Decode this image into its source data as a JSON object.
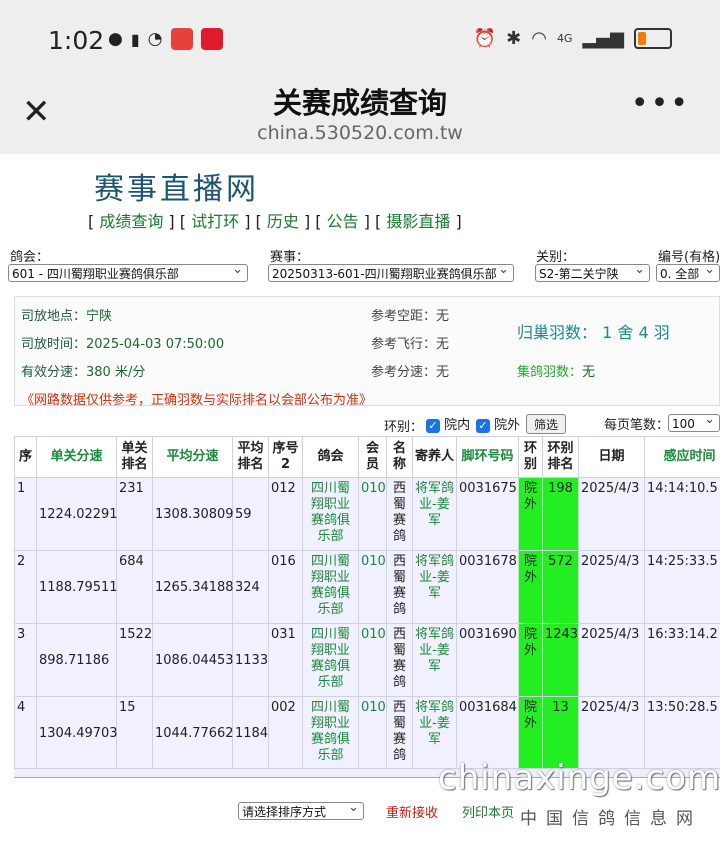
{
  "status_bar": {
    "time": "1:02",
    "network": "4G"
  },
  "nav": {
    "title": "关赛成绩查询",
    "url": "china.530520.com.tw"
  },
  "site": {
    "logo": "赛事直播网",
    "links": [
      "成绩查询",
      "试打环",
      "历史",
      "公告",
      "摄影直播"
    ]
  },
  "filters": {
    "club_label": "鸽会：",
    "club_value": "601 - 四川蜀翔职业赛鸽俱乐部",
    "race_label": "赛事：",
    "race_value": "20250313-601-四川蜀翔职业赛鸽俱乐部",
    "stage_label": "关别：",
    "stage_value": "S2-第二关宁陕",
    "number_label": "编号(有格)",
    "number_value": "0. 全部"
  },
  "info": {
    "release_place_label": "司放地点：",
    "release_place": "宁陕",
    "release_time_label": "司放时间：",
    "release_time": "2025-04-03 07:50:00",
    "speed_label": "有效分速：",
    "speed": "380 米/分",
    "ref_dist_label": "参考空距：",
    "ref_dist": "无",
    "ref_flight_label": "参考飞行：",
    "ref_flight": "无",
    "ref_speed_label": "参考分速：",
    "ref_speed": "无",
    "home_label": "归巢羽数：",
    "home_value": "1 舍 4 羽",
    "collect_label": "集鸽羽数：",
    "collect_value": "无",
    "notice": "《网路数据仅供参考，正确羽数与实际排名以会部公布为准》"
  },
  "filter_row": {
    "ring_label": "环别：",
    "inner_label": "院内",
    "outer_label": "院外",
    "filter_button": "筛选",
    "per_page_label": "每页笔数：",
    "per_page_value": "100"
  },
  "table": {
    "headers": [
      "序",
      "单关分速",
      "单关排名",
      "平均分速",
      "平均排名",
      "序号2",
      "鸽会",
      "会员",
      "名称",
      "寄养人",
      "脚环号码",
      "环别",
      "环别排名",
      "日期",
      "感应时间"
    ],
    "rows": [
      {
        "seq": "1",
        "speed": "1224.02291",
        "rank": "231",
        "avg_speed": "1308.30809",
        "avg_rank": "59",
        "seq2": "012",
        "club": "四川蜀翔职业赛鸽俱乐部",
        "member": "010",
        "name": "西蜀赛鸽",
        "foster": "将军鸽业-姜军",
        "ring": "0031675",
        "ring_type": "院外",
        "ring_rank": "198",
        "date": "2025/4/3",
        "time": "14:14:10.5"
      },
      {
        "seq": "2",
        "speed": "1188.79511",
        "rank": "684",
        "avg_speed": "1265.34188",
        "avg_rank": "324",
        "seq2": "016",
        "club": "四川蜀翔职业赛鸽俱乐部",
        "member": "010",
        "name": "西蜀赛鸽",
        "foster": "将军鸽业-姜军",
        "ring": "0031678",
        "ring_type": "院外",
        "ring_rank": "572",
        "date": "2025/4/3",
        "time": "14:25:33.5"
      },
      {
        "seq": "3",
        "speed": "898.71186",
        "rank": "1522",
        "avg_speed": "1086.04453",
        "avg_rank": "1133",
        "seq2": "031",
        "club": "四川蜀翔职业赛鸽俱乐部",
        "member": "010",
        "name": "西蜀赛鸽",
        "foster": "将军鸽业-姜军",
        "ring": "0031690",
        "ring_type": "院外",
        "ring_rank": "1243",
        "date": "2025/4/3",
        "time": "16:33:14.2"
      },
      {
        "seq": "4",
        "speed": "1304.49703",
        "rank": "15",
        "avg_speed": "1044.77662",
        "avg_rank": "1184",
        "seq2": "002",
        "club": "四川蜀翔职业赛鸽俱乐部",
        "member": "010",
        "name": "西蜀赛鸽",
        "foster": "将军鸽业-姜军",
        "ring": "0031684",
        "ring_type": "院外",
        "ring_rank": "13",
        "date": "2025/4/3",
        "time": "13:50:28.5"
      }
    ]
  },
  "footer": {
    "sort_placeholder": "请选择排序方式",
    "reload": "重新接收",
    "print": "列印本页"
  },
  "watermark": {
    "domain": "chinaxinge.com",
    "cn": "中国信鸽信息网"
  },
  "colors": {
    "accent_green": "#1a8a3a",
    "highlight_green": "#22ee22",
    "notice_red": "#d03010",
    "logo_blue": "#1b5576"
  }
}
